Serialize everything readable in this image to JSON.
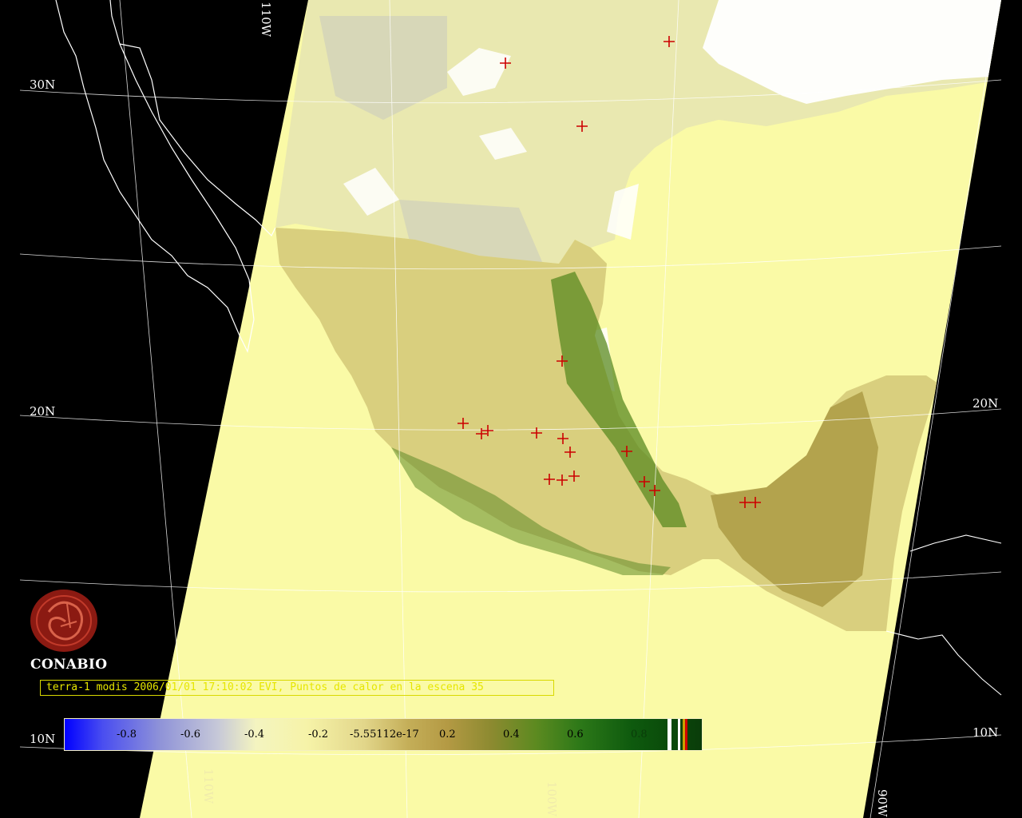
{
  "grid_labels": {
    "lat_30n_left": "30N",
    "lat_20n_left": "20N",
    "lat_10n_left": "10N",
    "lat_20n_right": "20N",
    "lat_10n_right": "10N",
    "lon_110w_top": "110W",
    "lon_110w_bottom": "110W",
    "lon_100w_bottom": "100W",
    "lon_90w_bottom": "90W"
  },
  "logo": {
    "text": "CONABIO"
  },
  "caption": "terra-1 modis 2006/01/01 17:10:02 EVI, Puntos de calor en la escena 35",
  "colorbar": {
    "ticks": [
      "-0.8",
      "-0.6",
      "-0.4",
      "-0.2",
      "-5.55112e-17",
      "0.2",
      "0.4",
      "0.6",
      "0.8"
    ],
    "colors": {
      "low": "#0000ff",
      "mid": "#f4f4c0",
      "high": "#0a3c0a",
      "markers": [
        "#ffffff",
        "#ffffff",
        "#c8a000",
        "#d00000"
      ]
    }
  },
  "colors": {
    "swath_fill": "#fafaa6",
    "coastline": "#ffffff",
    "graticule": "#ffffff",
    "hotspot": "#cc0000"
  }
}
